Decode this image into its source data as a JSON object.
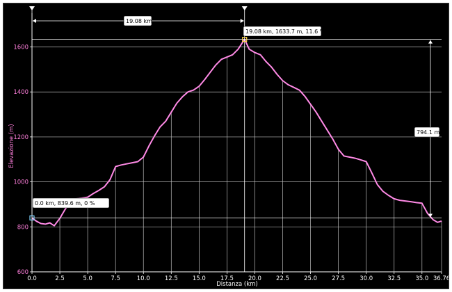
{
  "chart_data": {
    "type": "area",
    "xlabel": "Distanza (km)",
    "ylabel": "Elevazione (m)",
    "xlim": [
      0,
      36.76
    ],
    "ylim": [
      600,
      1750
    ],
    "x_ticks": [
      0,
      2.5,
      5,
      7.5,
      10,
      12.5,
      15,
      17.5,
      20,
      22.5,
      25,
      27.5,
      30,
      32.5,
      35,
      36.76
    ],
    "x_tick_labels": [
      "0.0",
      "2.5",
      "5.0",
      "7.5",
      "10.0",
      "12.5",
      "15.0",
      "17.5",
      "20.0",
      "22.5",
      "25.0",
      "27.5",
      "30.0",
      "32.5",
      "35.0",
      "36.76"
    ],
    "y_ticks": [
      600,
      800,
      1000,
      1200,
      1400,
      1600
    ],
    "y_tick_labels": [
      "600",
      "800",
      "1000",
      "1200",
      "1400",
      "1600"
    ],
    "grid": true,
    "line_color": "#ff8ae6",
    "series": [
      {
        "x": [
          0,
          0.4,
          0.8,
          1.2,
          1.6,
          2.0,
          2.5,
          3.0,
          3.5,
          4.0,
          4.5,
          5.0,
          5.5,
          6.0,
          6.5,
          7.0,
          7.5,
          8.0,
          8.5,
          9.0,
          9.5,
          10.0,
          10.5,
          11.0,
          11.5,
          12.0,
          12.5,
          13.0,
          13.5,
          14.0,
          14.5,
          15.0,
          15.5,
          16.0,
          16.5,
          17.0,
          17.5,
          18.0,
          18.5,
          19.08,
          19.5,
          20.0,
          20.5,
          21.0,
          21.5,
          22.0,
          22.5,
          23.0,
          23.5,
          24.0,
          24.5,
          25.0,
          25.5,
          26.0,
          26.5,
          27.0,
          27.5,
          28.0,
          28.5,
          29.0,
          29.5,
          30.0,
          30.5,
          31.0,
          31.5,
          32.0,
          32.5,
          33.0,
          33.5,
          34.0,
          34.5,
          35.0,
          35.5,
          36.0,
          36.4,
          36.76
        ],
        "y": [
          839.6,
          825,
          815,
          812,
          818,
          805,
          838,
          880,
          912,
          925,
          928,
          932,
          948,
          962,
          978,
          1010,
          1068,
          1075,
          1080,
          1085,
          1090,
          1110,
          1160,
          1205,
          1245,
          1270,
          1310,
          1350,
          1378,
          1400,
          1408,
          1425,
          1455,
          1488,
          1520,
          1545,
          1555,
          1565,
          1590,
          1633.7,
          1590,
          1575,
          1565,
          1535,
          1510,
          1478,
          1450,
          1432,
          1420,
          1408,
          1380,
          1345,
          1310,
          1270,
          1230,
          1190,
          1145,
          1115,
          1110,
          1105,
          1098,
          1090,
          1040,
          988,
          958,
          940,
          925,
          918,
          915,
          912,
          908,
          905,
          860,
          832,
          820,
          826
        ]
      }
    ],
    "annotations": {
      "start_label": "0.0 km, 839.6 m, 0 %",
      "peak_label": "19.08 km, 1633.7 m, 11.6 %",
      "distance_label": "19.08 km",
      "elevation_delta_label": "794.1 m",
      "start_x": 0,
      "start_y": 839.6,
      "peak_x": 19.08,
      "peak_y": 1633.7,
      "min_y": 839.6
    }
  }
}
